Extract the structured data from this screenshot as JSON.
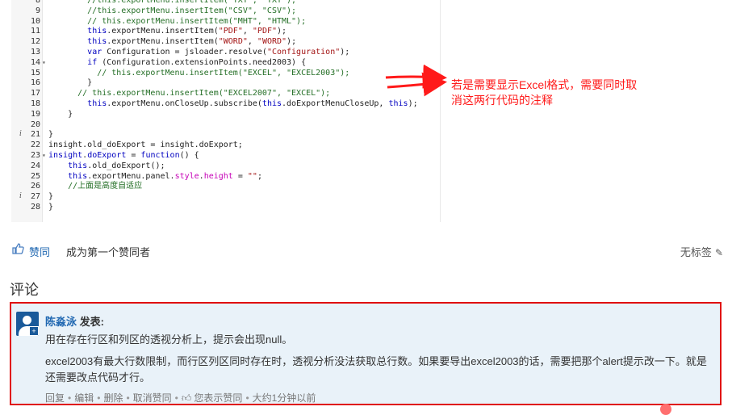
{
  "code": {
    "lines": [
      {
        "n": "8",
        "info": "",
        "fold": "",
        "parts": [
          [
            "cm",
            "        //this.exportMenu.insertItem(\"TXT\", \"TXT\");"
          ]
        ]
      },
      {
        "n": "9",
        "info": "",
        "fold": "",
        "parts": [
          [
            "cm",
            "        //this.exportMenu.insertItem(\"CSV\", \"CSV\");"
          ]
        ]
      },
      {
        "n": "10",
        "info": "",
        "fold": "",
        "parts": [
          [
            "cm",
            "        // this.exportMenu.insertItem(\"MHT\", \"HTML\");"
          ]
        ]
      },
      {
        "n": "11",
        "info": "",
        "fold": "",
        "parts": [
          [
            "pl",
            "        "
          ],
          [
            "kw",
            "this"
          ],
          [
            "pl",
            ".exportMenu.insertItem("
          ],
          [
            "st",
            "\"PDF\""
          ],
          [
            "pl",
            ", "
          ],
          [
            "st",
            "\"PDF\""
          ],
          [
            "pl",
            ");"
          ]
        ]
      },
      {
        "n": "12",
        "info": "",
        "fold": "",
        "parts": [
          [
            "pl",
            "        "
          ],
          [
            "kw",
            "this"
          ],
          [
            "pl",
            ".exportMenu.insertItem("
          ],
          [
            "st",
            "\"WORD\""
          ],
          [
            "pl",
            ", "
          ],
          [
            "st",
            "\"WORD\""
          ],
          [
            "pl",
            ");"
          ]
        ]
      },
      {
        "n": "13",
        "info": "",
        "fold": "",
        "parts": [
          [
            "pl",
            "        "
          ],
          [
            "kw",
            "var"
          ],
          [
            "pl",
            " Configuration = jsloader.resolve("
          ],
          [
            "st",
            "\"Configuration\""
          ],
          [
            "pl",
            ");"
          ]
        ]
      },
      {
        "n": "14",
        "info": "",
        "fold": "▾",
        "parts": [
          [
            "pl",
            "        "
          ],
          [
            "kw",
            "if"
          ],
          [
            "pl",
            " (Configuration.extensionPoints.need2003) {"
          ]
        ]
      },
      {
        "n": "15",
        "info": "",
        "fold": "",
        "parts": [
          [
            "cm",
            "          // this.exportMenu.insertItem(\"EXCEL\", \"EXCEL2003\");"
          ]
        ]
      },
      {
        "n": "16",
        "info": "",
        "fold": "",
        "parts": [
          [
            "pl",
            "        }"
          ]
        ]
      },
      {
        "n": "17",
        "info": "",
        "fold": "",
        "parts": [
          [
            "cm",
            "      // this.exportMenu.insertItem(\"EXCEL2007\", \"EXCEL\");"
          ]
        ]
      },
      {
        "n": "18",
        "info": "",
        "fold": "",
        "parts": [
          [
            "pl",
            "        "
          ],
          [
            "kw",
            "this"
          ],
          [
            "pl",
            ".exportMenu.onCloseUp.subscribe("
          ],
          [
            "kw",
            "this"
          ],
          [
            "pl",
            ".doExportMenuCloseUp, "
          ],
          [
            "kw",
            "this"
          ],
          [
            "pl",
            ");"
          ]
        ]
      },
      {
        "n": "19",
        "info": "",
        "fold": "",
        "parts": [
          [
            "pl",
            "    }"
          ]
        ]
      },
      {
        "n": "20",
        "info": "",
        "fold": "",
        "parts": [
          [
            "pl",
            ""
          ]
        ]
      },
      {
        "n": "21",
        "info": "i",
        "fold": "",
        "parts": [
          [
            "pl",
            "}"
          ]
        ]
      },
      {
        "n": "22",
        "info": "",
        "fold": "",
        "parts": [
          [
            "pl",
            "insight.old_doExport = insight.doExport;"
          ]
        ]
      },
      {
        "n": "23",
        "info": "",
        "fold": "▾",
        "parts": [
          [
            "kw",
            "insight"
          ],
          [
            "pl",
            "."
          ],
          [
            "kw",
            "doExport"
          ],
          [
            "pl",
            " = "
          ],
          [
            "kw",
            "function"
          ],
          [
            "pl",
            "() {"
          ]
        ]
      },
      {
        "n": "24",
        "info": "",
        "fold": "",
        "parts": [
          [
            "pl",
            "    "
          ],
          [
            "kw",
            "this"
          ],
          [
            "pl",
            ".old_doExport();"
          ]
        ]
      },
      {
        "n": "25",
        "info": "",
        "fold": "",
        "parts": [
          [
            "pl",
            "    "
          ],
          [
            "kw",
            "this"
          ],
          [
            "pl",
            ".exportMenu.panel."
          ],
          [
            "pr",
            "style"
          ],
          [
            "pl",
            "."
          ],
          [
            "pr",
            "height"
          ],
          [
            "pl",
            " = "
          ],
          [
            "st",
            "\"\""
          ],
          [
            "pl",
            ";"
          ]
        ]
      },
      {
        "n": "26",
        "info": "",
        "fold": "",
        "parts": [
          [
            "cm",
            "    //上面是高度自适应"
          ]
        ]
      },
      {
        "n": "27",
        "info": "i",
        "fold": "",
        "parts": [
          [
            "pl",
            "}"
          ]
        ]
      },
      {
        "n": "28",
        "info": "",
        "fold": "",
        "parts": [
          [
            "pl",
            "}"
          ]
        ]
      }
    ],
    "info_marks": {
      "21": "i",
      "27": "i"
    }
  },
  "annotation": {
    "line1": "若是需要显示Excel格式，需要同时取",
    "line2": "消这两行代码的注释",
    "color": "#ff1a1a"
  },
  "likebar": {
    "like_label": "赞同",
    "first_like": "成为第一个赞同者",
    "tag_label": "无标签",
    "icons": {
      "like": "thumbs-up-icon",
      "tag": "pencil-icon"
    }
  },
  "comments": {
    "title": "评论",
    "items": [
      {
        "author": "陈淼泳",
        "said": "发表:",
        "line1": "用在存在行区和列区的透视分析上，提示会出现null。",
        "line2": "excel2003有最大行数限制，而行区列区同时存在时，透视分析没法获取总行数。如果要导出excel2003的话，需要把那个alert提示改一下。就是还需要改点代码才行。",
        "actions": {
          "reply": "回复",
          "edit": "编辑",
          "delete": "删除",
          "unlike": "取消赞同",
          "liked": "您表示赞同",
          "time": "大约1分钟以前"
        }
      }
    ]
  },
  "colors": {
    "link": "#1f67b1",
    "highlight_border": "#e01010",
    "comment_bg": "#e9f2f9"
  }
}
